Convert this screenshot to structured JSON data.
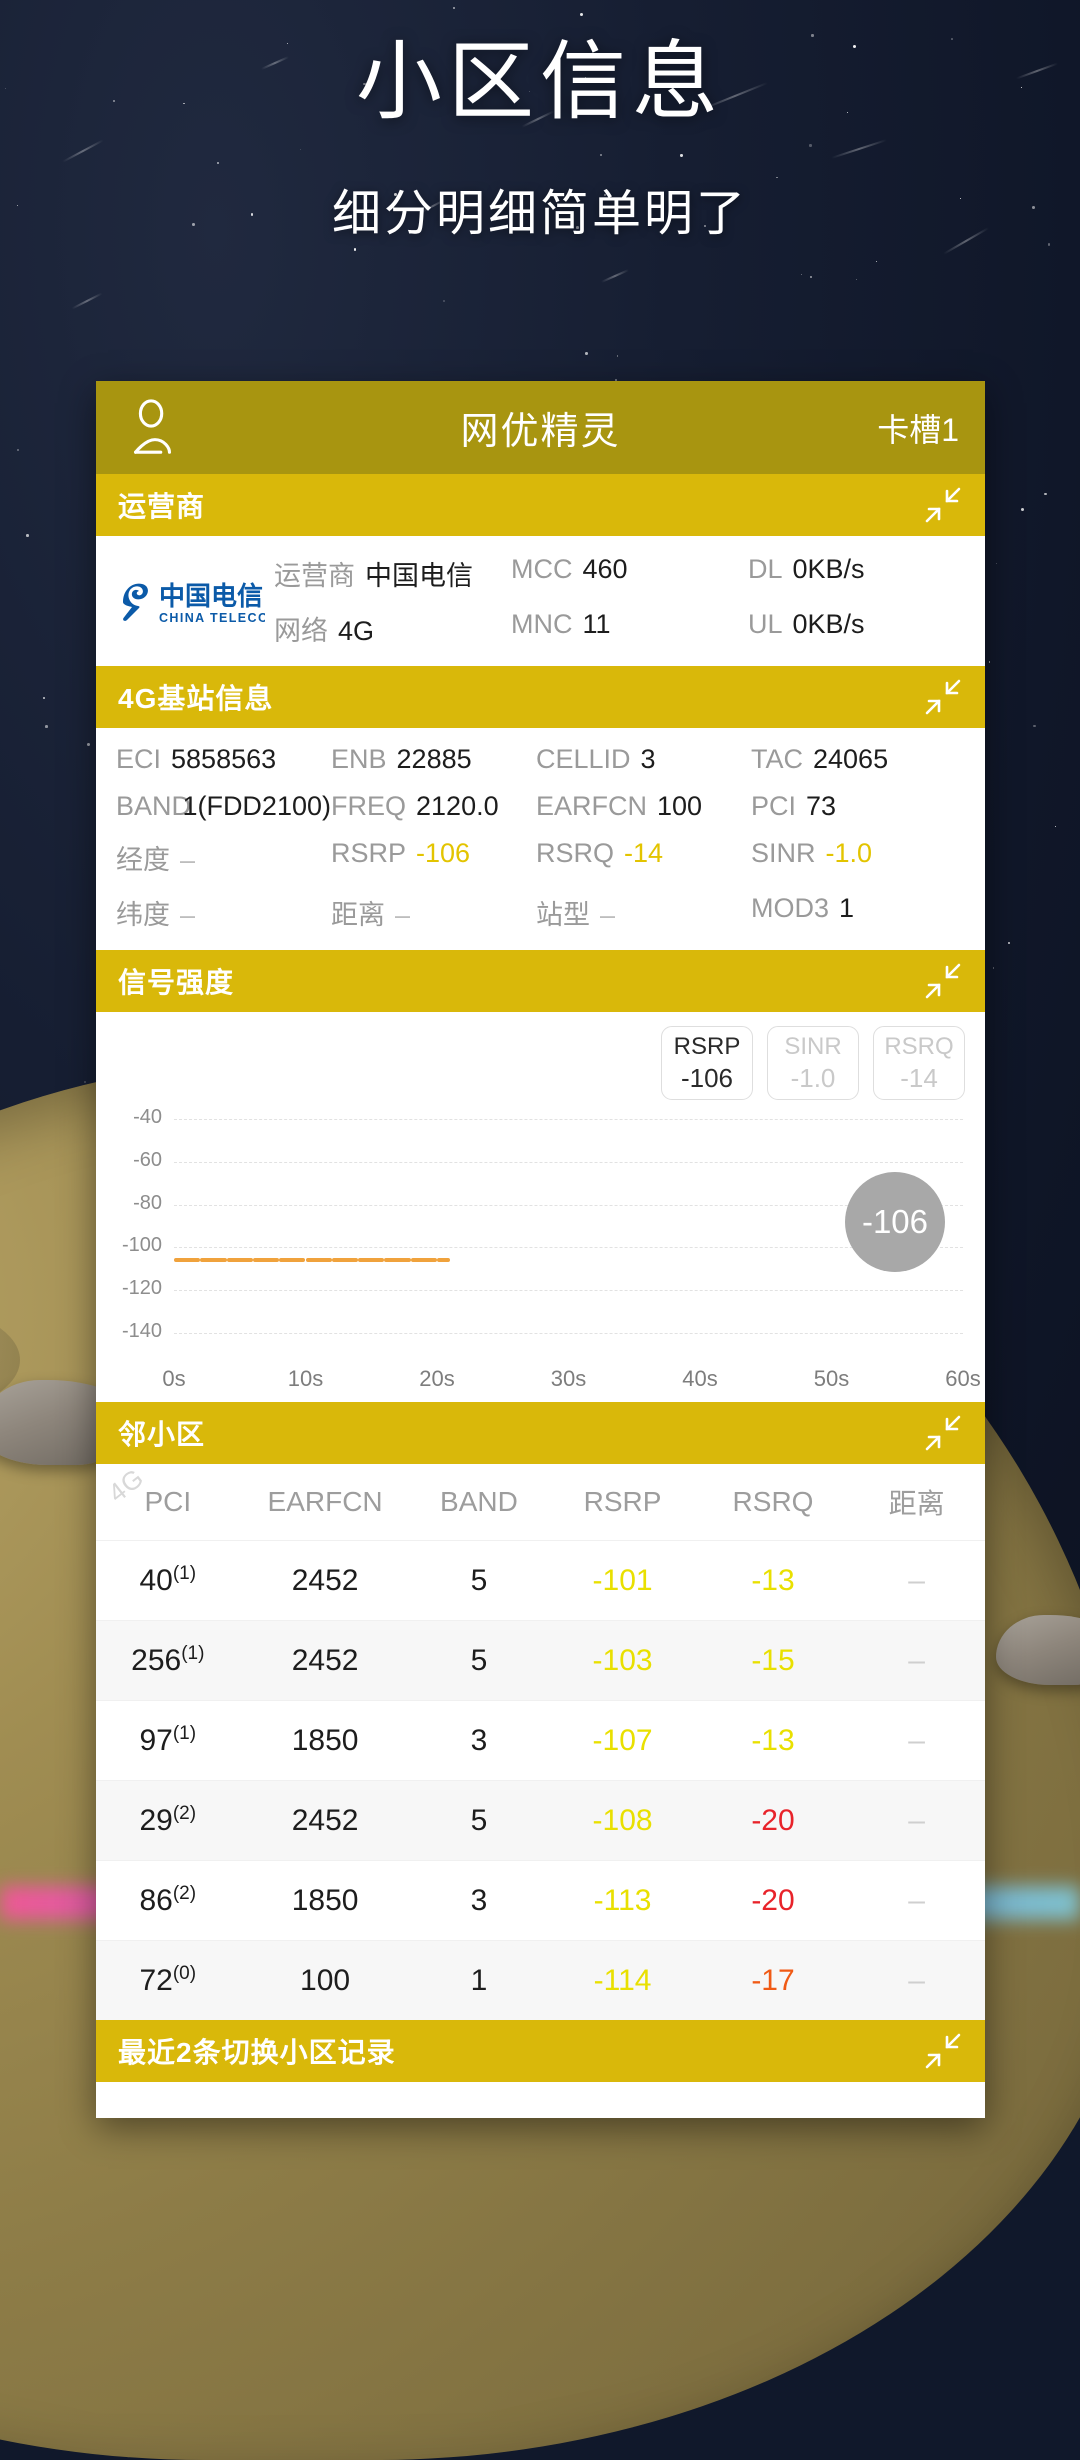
{
  "hero": {
    "title": "小区信息",
    "subtitle": "细分明细简单明了"
  },
  "app": {
    "title": "网优精灵",
    "slot_label": "卡槽1",
    "avatar_icon": "user-icon",
    "collapse_icon": "collapse-arrows-icon"
  },
  "operator_section": {
    "title": "运营商",
    "logo": {
      "cn": "中国电信",
      "en": "CHINA TELECOM",
      "color": "#0b5aa8"
    },
    "fields": [
      {
        "key": "运营商",
        "value": "中国电信"
      },
      {
        "key": "MCC",
        "value": "460"
      },
      {
        "key": "DL",
        "value": "0KB/s"
      },
      {
        "key": "网络",
        "value": "4G"
      },
      {
        "key": "MNC",
        "value": "11"
      },
      {
        "key": "UL",
        "value": "0KB/s"
      }
    ]
  },
  "base_section": {
    "title": "4G基站信息",
    "fields": [
      {
        "key": "ECI",
        "value": "5858563",
        "style": "normal"
      },
      {
        "key": "ENB",
        "value": "22885",
        "style": "normal"
      },
      {
        "key": "CELLID",
        "value": "3",
        "style": "normal"
      },
      {
        "key": "TAC",
        "value": "24065",
        "style": "normal"
      },
      {
        "key": "BAND",
        "value": "1(FDD2100)",
        "style": "normal"
      },
      {
        "key": "FREQ",
        "value": "2120.0",
        "style": "normal"
      },
      {
        "key": "EARFCN",
        "value": "100",
        "style": "normal"
      },
      {
        "key": "PCI",
        "value": "73",
        "style": "normal"
      },
      {
        "key": "经度",
        "value": "–",
        "style": "dash"
      },
      {
        "key": "RSRP",
        "value": "-106",
        "style": "yellow"
      },
      {
        "key": "RSRQ",
        "value": "-14",
        "style": "yellow"
      },
      {
        "key": "SINR",
        "value": "-1.0",
        "style": "yellow"
      },
      {
        "key": "纬度",
        "value": "–",
        "style": "dash"
      },
      {
        "key": "距离",
        "value": "–",
        "style": "dash"
      },
      {
        "key": "站型",
        "value": "–",
        "style": "dash"
      },
      {
        "key": "MOD3",
        "value": "1",
        "style": "normal"
      }
    ]
  },
  "signal_section": {
    "title": "信号强度",
    "chips": [
      {
        "label": "RSRP",
        "value": "-106",
        "active": true
      },
      {
        "label": "SINR",
        "value": "-1.0",
        "active": false
      },
      {
        "label": "RSRQ",
        "value": "-14",
        "active": false
      }
    ],
    "bubble_value": "-106"
  },
  "chart_data": {
    "type": "line",
    "title": "信号强度",
    "series": [
      {
        "name": "RSRP",
        "color": "#f0a23c",
        "x": [
          0,
          2,
          4,
          6,
          8,
          10,
          12,
          14,
          16,
          18,
          20,
          21
        ],
        "values": [
          -106,
          -106,
          -106,
          -106,
          -106,
          -106,
          -106,
          -106,
          -106,
          -106,
          -106,
          -106
        ]
      }
    ],
    "xlabel": "",
    "ylabel": "",
    "xlim": [
      0,
      60
    ],
    "ylim": [
      -145,
      -35
    ],
    "xticks": [
      "0s",
      "10s",
      "20s",
      "30s",
      "40s",
      "50s",
      "60s"
    ],
    "yticks": [
      "-40",
      "-60",
      "-80",
      "-100",
      "-120",
      "-140"
    ],
    "grid": true,
    "legend": "none",
    "annotations": [
      {
        "text": "-106",
        "type": "current-value-bubble"
      }
    ]
  },
  "neighbor_section": {
    "title": "邻小区",
    "watermark": "4G",
    "columns": [
      "PCI",
      "EARFCN",
      "BAND",
      "RSRP",
      "RSRQ",
      "距离"
    ],
    "rows": [
      {
        "pci": "40",
        "sup": "(1)",
        "earfcn": "2452",
        "band": "5",
        "rsrp": "-101",
        "rsrp_color": "yellow",
        "rsrq": "-13",
        "rsrq_color": "yellow",
        "dist": "–"
      },
      {
        "pci": "256",
        "sup": "(1)",
        "earfcn": "2452",
        "band": "5",
        "rsrp": "-103",
        "rsrp_color": "yellow",
        "rsrq": "-15",
        "rsrq_color": "yellow",
        "dist": "–"
      },
      {
        "pci": "97",
        "sup": "(1)",
        "earfcn": "1850",
        "band": "3",
        "rsrp": "-107",
        "rsrp_color": "yellow",
        "rsrq": "-13",
        "rsrq_color": "yellow",
        "dist": "–"
      },
      {
        "pci": "29",
        "sup": "(2)",
        "earfcn": "2452",
        "band": "5",
        "rsrp": "-108",
        "rsrp_color": "yellow",
        "rsrq": "-20",
        "rsrq_color": "red",
        "dist": "–"
      },
      {
        "pci": "86",
        "sup": "(2)",
        "earfcn": "1850",
        "band": "3",
        "rsrp": "-113",
        "rsrp_color": "yellow",
        "rsrq": "-20",
        "rsrq_color": "red",
        "dist": "–"
      },
      {
        "pci": "72",
        "sup": "(0)",
        "earfcn": "100",
        "band": "1",
        "rsrp": "-114",
        "rsrp_color": "yellow",
        "rsrq": "-17",
        "rsrq_color": "orange",
        "dist": "–"
      }
    ]
  },
  "handover_section": {
    "title": "最近2条切换小区记录"
  },
  "theme": {
    "header_gold": "#a89510",
    "section_gold": "#d9b80a",
    "value_yellow": "#e3c400",
    "series_orange": "#f0a23c"
  }
}
